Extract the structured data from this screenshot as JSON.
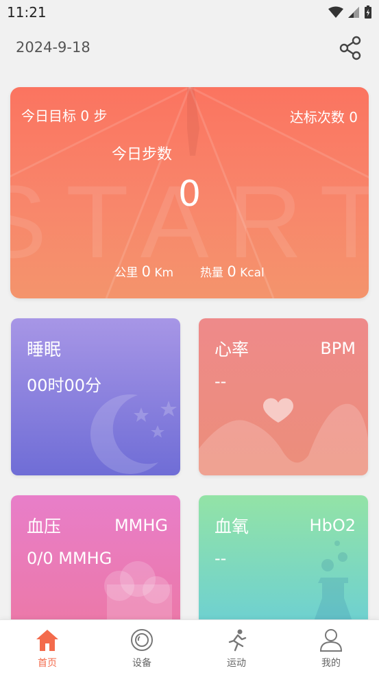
{
  "status_bar": {
    "time": "11:21"
  },
  "header": {
    "date": "2024-9-18"
  },
  "steps_card": {
    "goal_label": "今日目标",
    "goal_value": "0",
    "goal_unit": "步",
    "achieve_label": "达标次数",
    "achieve_value": "0",
    "title": "今日步数",
    "steps": "0",
    "distance_label": "公里",
    "distance_value": "0",
    "distance_unit": "Km",
    "calorie_label": "热量",
    "calorie_value": "0",
    "calorie_unit": "Kcal"
  },
  "cards": {
    "sleep": {
      "title": "睡眠",
      "value": "00时00分"
    },
    "heart": {
      "title": "心率",
      "unit": "BPM",
      "value": "--"
    },
    "bp": {
      "title": "血压",
      "unit": "MMHG",
      "value": "0/0 MMHG"
    },
    "spo2": {
      "title": "血氧",
      "unit": "HbO2",
      "value": "--"
    }
  },
  "nav": {
    "home": "首页",
    "device": "设备",
    "sport": "运动",
    "mine": "我的"
  },
  "colors": {
    "accent": "#f36b4c"
  }
}
